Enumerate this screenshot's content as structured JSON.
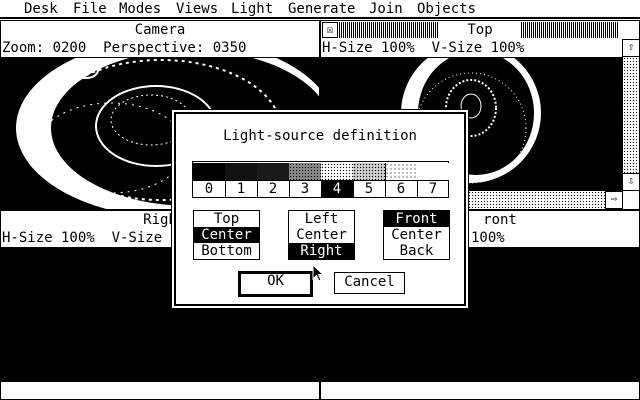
{
  "menubar": {
    "items": [
      "Desk",
      "File",
      "Modes",
      "Views",
      "Light",
      "Generate",
      "Join",
      "Objects"
    ]
  },
  "windows": {
    "camera": {
      "title": "Camera",
      "info": "Zoom: 0200  Perspective: 0350"
    },
    "top": {
      "title": "Top",
      "info": "H-Size 100%  V-Size 100%"
    },
    "right": {
      "title": "Righ",
      "info": "H-Size 100%  V-Size 10"
    },
    "front": {
      "title": "ront",
      "info": "100%"
    }
  },
  "dialog": {
    "title": "Light-source definition",
    "shades": [
      "0",
      "1",
      "2",
      "3",
      "4",
      "5",
      "6",
      "7"
    ],
    "selected_shade": "4",
    "vertical": {
      "options": [
        "Top",
        "Center",
        "Bottom"
      ],
      "selected": "Center"
    },
    "horizontal": {
      "options": [
        "Left",
        "Center",
        "Right"
      ],
      "selected": "Right"
    },
    "depth": {
      "options": [
        "Front",
        "Center",
        "Back"
      ],
      "selected": "Front"
    },
    "ok_label": "OK",
    "cancel_label": "Cancel"
  },
  "icons": {
    "close": "☒",
    "up": "⇧",
    "down": "⇩",
    "right": "⇨"
  }
}
